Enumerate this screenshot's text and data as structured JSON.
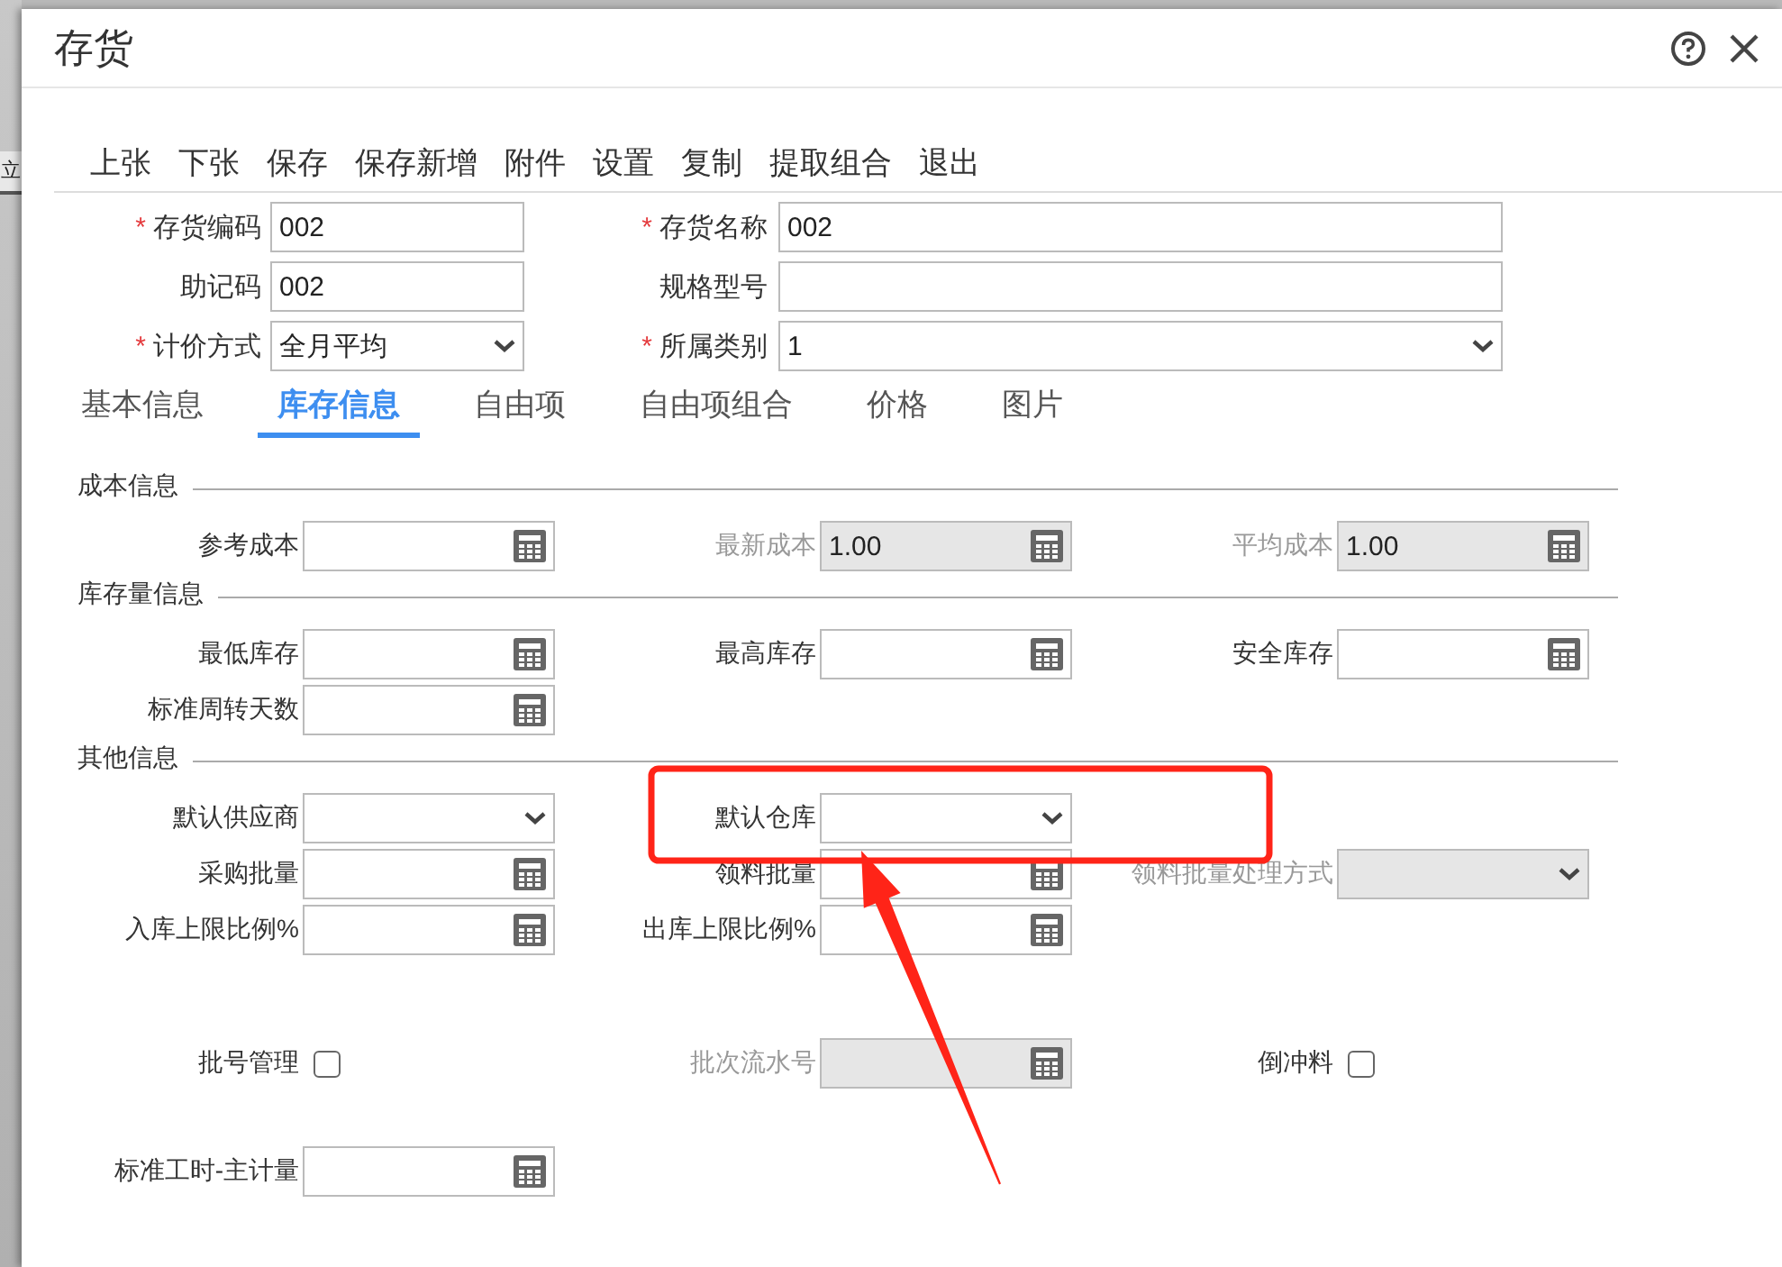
{
  "background": {
    "text": "立"
  },
  "window": {
    "title": "存货"
  },
  "toolbar": [
    "上张",
    "下张",
    "保存",
    "保存新增",
    "附件",
    "设置",
    "复制",
    "提取组合",
    "退出"
  ],
  "header_fields": [
    {
      "marker": "*",
      "label": "存货编码",
      "kind": "text",
      "value": "002"
    },
    {
      "marker": "*",
      "label": "存货名称",
      "kind": "text",
      "value": "002"
    },
    {
      "label": "助记码",
      "kind": "text",
      "value": "002"
    },
    {
      "label": "规格型号",
      "kind": "text"
    },
    {
      "marker": "*",
      "label": "计价方式",
      "kind": "select",
      "value": "全月平均"
    },
    {
      "marker": "*",
      "label": "所属类别",
      "kind": "select",
      "value": "1"
    }
  ],
  "tabs": [
    {
      "label": "基本信息",
      "selected": false
    },
    {
      "label": "库存信息",
      "selected": true
    },
    {
      "label": "自由项",
      "selected": false
    },
    {
      "label": "自由项组合",
      "selected": false
    },
    {
      "label": "价格",
      "selected": false
    },
    {
      "label": "图片",
      "selected": false
    }
  ],
  "sections": [
    {
      "title": "成本信息",
      "rows": [
        [
          {
            "label": "参考成本",
            "kind": "number",
            "disabled": false
          },
          {
            "label": "最新成本",
            "kind": "number",
            "disabled": true,
            "value": "1.00"
          },
          {
            "label": "平均成本",
            "kind": "number",
            "disabled": true,
            "value": "1.00"
          }
        ]
      ]
    },
    {
      "title": "库存量信息",
      "rows": [
        [
          {
            "label": "最低库存",
            "kind": "number",
            "disabled": false
          },
          {
            "label": "最高库存",
            "kind": "number",
            "disabled": false
          },
          {
            "label": "安全库存",
            "kind": "number",
            "disabled": false
          }
        ],
        [
          {
            "label": "标准周转天数",
            "kind": "number",
            "disabled": false
          }
        ]
      ]
    },
    {
      "title": "其他信息",
      "rows": [
        [
          {
            "label": "默认供应商",
            "kind": "select",
            "disabled": false
          },
          {
            "label": "默认仓库",
            "kind": "select",
            "disabled": false
          }
        ],
        [
          {
            "label": "采购批量",
            "kind": "number",
            "disabled": false
          },
          {
            "label": "领料批量",
            "kind": "number",
            "disabled": false
          },
          {
            "label": "领料批量处理方式",
            "kind": "select",
            "disabled": true
          }
        ],
        [
          {
            "label": "入库上限比例%",
            "kind": "number",
            "disabled": false
          },
          {
            "label": "出库上限比例%",
            "kind": "number",
            "disabled": false
          }
        ]
      ]
    }
  ],
  "extra_rows": [
    [
      {
        "label": "批号管理",
        "kind": "checkbox",
        "checked": false
      },
      {
        "label": "批次流水号",
        "kind": "number",
        "disabled": true
      },
      {
        "label": "倒冲料",
        "kind": "checkbox",
        "checked": false
      }
    ],
    [
      {
        "label": "标准工时-主计量",
        "kind": "number",
        "disabled": false
      }
    ]
  ],
  "annotation": {
    "highlight_frame": true,
    "arrow": true
  }
}
